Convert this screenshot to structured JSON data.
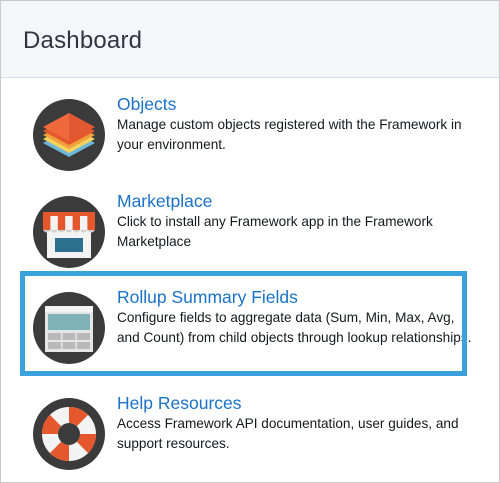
{
  "header": {
    "title": "Dashboard"
  },
  "items": [
    {
      "title": "Objects",
      "description": "Manage custom objects registered with the Framework in your environment.",
      "icon": "layers-icon"
    },
    {
      "title": "Marketplace",
      "description": "Click to install any Framework app in the Framework Marketplace",
      "icon": "storefront-icon"
    },
    {
      "title": "Rollup Summary Fields",
      "description": "Configure fields to aggregate data (Sum, Min, Max, Avg, and Count) from child objects through lookup relationships.",
      "icon": "table-icon",
      "highlighted": true
    },
    {
      "title": "Help Resources",
      "description": "Access Framework API documentation, user guides, and support resources.",
      "icon": "lifebuoy-icon"
    }
  ],
  "colors": {
    "link": "#1a73c9",
    "highlight_border": "#3aa1dc",
    "icon_background": "#3b3b3b"
  }
}
